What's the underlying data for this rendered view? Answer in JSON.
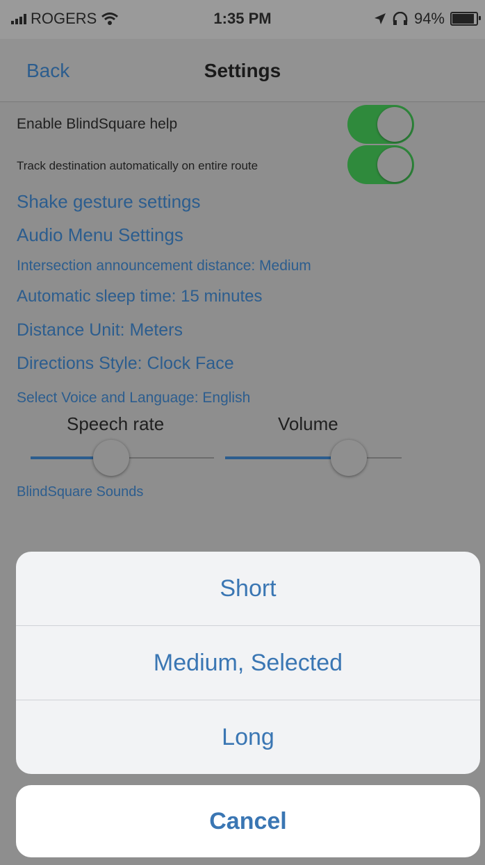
{
  "statusbar": {
    "carrier": "ROGERS",
    "time": "1:35 PM",
    "battery": "94%",
    "battery_level": 0.94,
    "icons": [
      "signal-icon",
      "wifi-icon",
      "location-icon",
      "headphones-icon",
      "battery-icon"
    ]
  },
  "nav": {
    "back": "Back",
    "title": "Settings"
  },
  "settings": {
    "enable_help": {
      "label": "Enable BlindSquare help",
      "on": true
    },
    "track_destination": {
      "label": "Track destination automatically on entire route",
      "on": true
    },
    "shake_gesture": "Shake gesture settings",
    "audio_menu": "Audio Menu Settings",
    "intersection_distance": "Intersection announcement distance: Medium",
    "sleep_time": "Automatic sleep time: 15 minutes",
    "distance_unit": "Distance Unit: Meters",
    "directions_style": "Directions Style: Clock Face",
    "voice_language": "Select Voice and Language: English",
    "speech_rate": {
      "label": "Speech rate",
      "value": 0.44
    },
    "volume": {
      "label": "Volume",
      "value": 0.7
    },
    "sounds": "BlindSquare Sounds"
  },
  "action_sheet": {
    "options": [
      "Short",
      "Medium, Selected",
      "Long"
    ],
    "cancel": "Cancel"
  },
  "colors": {
    "link": "#2c5d8e",
    "toggle_on": "#2f8a3c",
    "sheet_text": "#3a76b3"
  }
}
